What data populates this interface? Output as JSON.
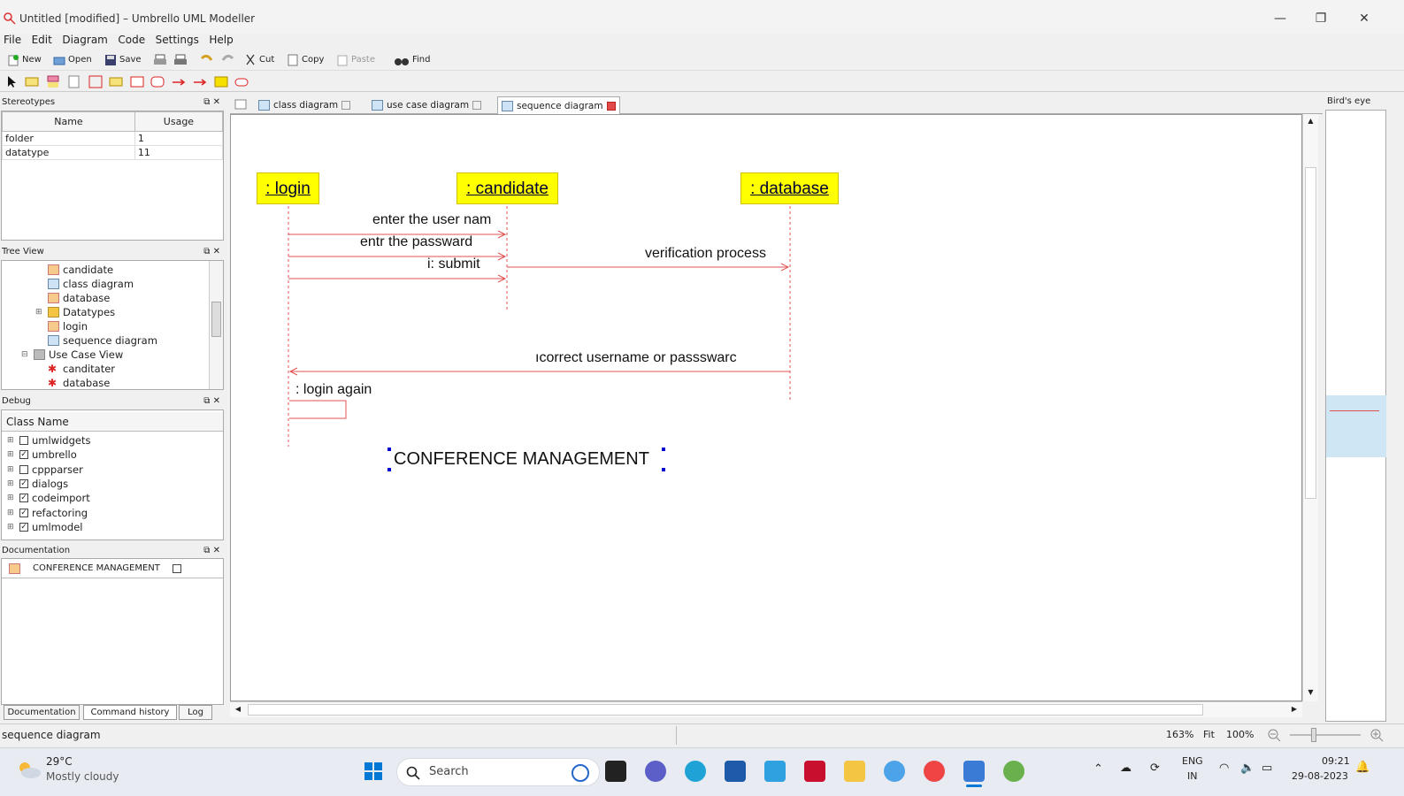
{
  "window": {
    "title": "Untitled [modified] – Umbrello UML Modeller",
    "min": "—",
    "restore": "❐",
    "close": "✕"
  },
  "menu": [
    "File",
    "Edit",
    "Diagram",
    "Code",
    "Settings",
    "Help"
  ],
  "toolbar": {
    "new": "New",
    "open": "Open",
    "save": "Save",
    "cut": "Cut",
    "copy": "Copy",
    "paste": "Paste",
    "find": "Find"
  },
  "stereotypes": {
    "title": "Stereotypes",
    "columns": [
      "Name",
      "Usage"
    ],
    "rows": [
      [
        "folder",
        "1"
      ],
      [
        "datatype",
        "11"
      ]
    ]
  },
  "tree": {
    "title": "Tree View",
    "items": [
      "candidate",
      "class diagram",
      "database",
      "Datatypes",
      "login",
      "sequence diagram",
      "Use Case View",
      "canditater",
      "database"
    ]
  },
  "debug": {
    "title": "Debug",
    "column": "Class Name",
    "items": [
      {
        "label": "umlwidgets",
        "checked": false
      },
      {
        "label": "umbrello",
        "checked": true
      },
      {
        "label": "cppparser",
        "checked": false
      },
      {
        "label": "dialogs",
        "checked": true
      },
      {
        "label": "codeimport",
        "checked": true
      },
      {
        "label": "refactoring",
        "checked": true
      },
      {
        "label": "umlmodel",
        "checked": true
      }
    ]
  },
  "documentation": {
    "title": "Documentation",
    "item": "CONFERENCE MANAGEMENT"
  },
  "bottom_tabs": [
    "Documentation",
    "Command history",
    "Log"
  ],
  "tabs": [
    "class diagram",
    "use case diagram",
    "sequence diagram"
  ],
  "diagram": {
    "objects": [
      ": login",
      ": candidate",
      ": database"
    ],
    "messages": [
      "enter the user nam",
      "entr the passward",
      "i: submit",
      "verification process",
      "ıcorrect username or passswarc",
      ": login again"
    ],
    "note": "CONFERENCE MANAGEMENT"
  },
  "birds_eye": {
    "title": "Bird's eye"
  },
  "status": {
    "left": "sequence diagram",
    "zoom": "163%",
    "fit": "Fit",
    "full": "100%"
  },
  "taskbar": {
    "weather_temp": "29°C",
    "weather_desc": "Mostly cloudy",
    "search": "Search",
    "lang": "ENG",
    "region": "IN",
    "time": "09:21",
    "date": "29-08-2023"
  },
  "colors": {
    "object_fill": "#ffff00",
    "message_line": "#e05050",
    "windows_blue": "#0078d4"
  }
}
